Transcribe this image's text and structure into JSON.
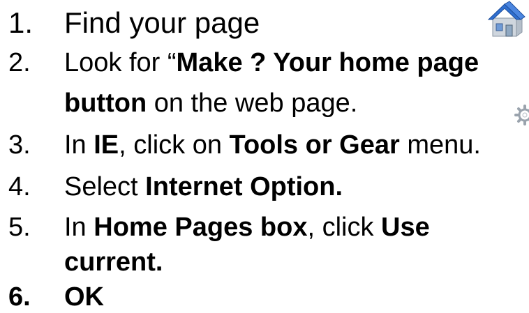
{
  "steps": [
    {
      "num": "1.",
      "segments": [
        {
          "text": "Find your page",
          "bold": false
        }
      ]
    },
    {
      "num": "2.",
      "segments": [
        {
          "text": "Look for “",
          "bold": false
        },
        {
          "text": "Make ? Your home page",
          "bold": true
        }
      ]
    },
    {
      "num": "",
      "segments": [
        {
          "text": "button",
          "bold": true
        },
        {
          "text": " on the web page.",
          "bold": false
        }
      ]
    },
    {
      "num": "3.",
      "segments": [
        {
          "text": "In ",
          "bold": false
        },
        {
          "text": "IE",
          "bold": true
        },
        {
          "text": ", click on ",
          "bold": false
        },
        {
          "text": "Tools or Gear",
          "bold": true
        },
        {
          "text": " menu.",
          "bold": false
        }
      ]
    },
    {
      "num": "4.",
      "segments": [
        {
          "text": "Select ",
          "bold": false
        },
        {
          "text": "Internet Option.",
          "bold": true
        }
      ]
    },
    {
      "num": "5.",
      "segments": [
        {
          "text": "In ",
          "bold": false
        },
        {
          "text": "Home Pages box",
          "bold": true
        },
        {
          "text": ", click ",
          "bold": false
        },
        {
          "text": "Use",
          "bold": true
        }
      ]
    },
    {
      "num": "",
      "segments": [
        {
          "text": "current.",
          "bold": true
        }
      ]
    },
    {
      "num": "6.",
      "bold_num": true,
      "segments": [
        {
          "text": "OK",
          "bold": true
        }
      ]
    }
  ],
  "icons": {
    "house": "house-icon",
    "gear": "gear-icon"
  },
  "colors": {
    "text": "#000000",
    "house_roof": "#2f6fd0",
    "house_wall": "#cfd6de",
    "gear": "#9aa3ad"
  }
}
